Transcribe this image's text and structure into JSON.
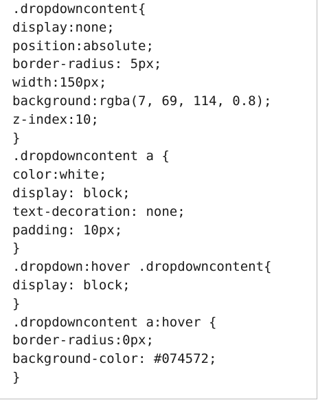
{
  "code": {
    "lines": [
      ".dropdowncontent{",
      "display:none;",
      "position:absolute;",
      "border-radius: 5px;",
      "width:150px;",
      "background:rgba(7, 69, 114, 0.8);",
      "z-index:10;",
      "}",
      ".dropdowncontent a {",
      "color:white;",
      "display: block;",
      "text-decoration: none;",
      "padding: 10px;",
      "}",
      ".dropdown:hover .dropdowncontent{",
      "display: block;",
      "}",
      ".dropdowncontent a:hover {",
      "border-radius:0px;",
      "background-color: #074572;",
      "}"
    ]
  }
}
